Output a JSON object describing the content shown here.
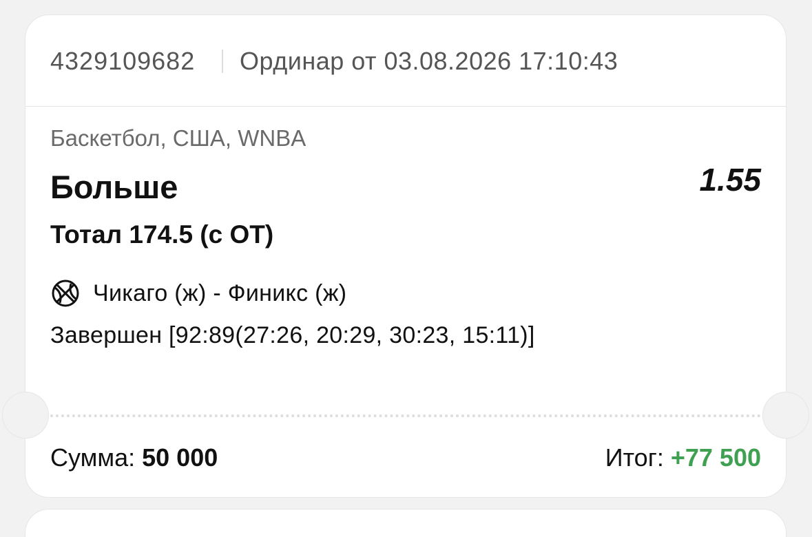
{
  "ticket": {
    "bet_id": "4329109682",
    "bet_type": "Ординар от 03.08.2026 17:10:43",
    "league": "Баскетбол, США, WNBA",
    "outcome": "Больше",
    "odds": "1.55",
    "market": "Тотал 174.5 (с ОТ)",
    "sport_icon": "basketball-icon",
    "match": "Чикаго (ж) - Финикс (ж)",
    "status": "Завершен [92:89(27:26, 20:29, 30:23, 15:11)]",
    "stake_label": "Сумма:",
    "stake_value": "50 000",
    "total_label": "Итог:",
    "total_value": "+77 500"
  },
  "colors": {
    "background": "#f2f2f2",
    "card": "#ffffff",
    "win_green": "#3fa052",
    "muted_text": "#555555"
  }
}
